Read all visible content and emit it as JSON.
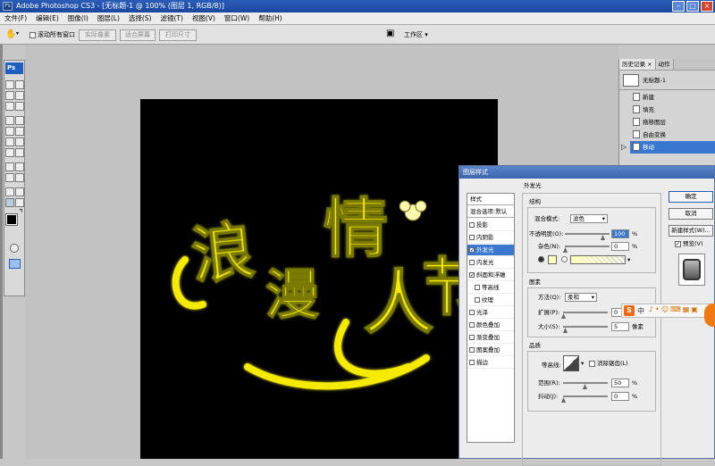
{
  "window": {
    "title": "Adobe Photoshop CS3 - [无标题-1 @ 100% (图层 1, RGB/8)]",
    "app_icon": "Ps"
  },
  "menu": [
    "文件(F)",
    "编辑(E)",
    "图像(I)",
    "图层(L)",
    "选择(S)",
    "滤镜(T)",
    "视图(V)",
    "窗口(W)",
    "帮助(H)"
  ],
  "options_bar": {
    "scroll_all_windows": "滚动所有窗口",
    "actual_pixels": "实际像素",
    "fit_screen": "适合屏幕",
    "print_size": "打印尺寸",
    "workspace": "工作区 ▾"
  },
  "toolbox": {
    "logo": "Ps"
  },
  "document": {
    "artwork_text": "浪漫情人节",
    "background": "#000000",
    "text_color": "#f5ea00"
  },
  "history_panel": {
    "tabs": [
      "历史记录 ×",
      "动作"
    ],
    "snapshot": "无标题-1",
    "steps": [
      "新建",
      "填充",
      "拖移图层",
      "自由变换",
      "移动"
    ],
    "selected_step": "移动"
  },
  "layer_style_dialog": {
    "title": "图层样式",
    "styles_header": "样式",
    "blend_options": "混合选项:默认",
    "styles": [
      {
        "label": "投影",
        "checked": false
      },
      {
        "label": "内阴影",
        "checked": false
      },
      {
        "label": "外发光",
        "checked": true,
        "selected": true
      },
      {
        "label": "内发光",
        "checked": false
      },
      {
        "label": "斜面和浮雕",
        "checked": true
      },
      {
        "label": "等高线",
        "checked": false,
        "sub": true
      },
      {
        "label": "纹理",
        "checked": false,
        "sub": true
      },
      {
        "label": "光泽",
        "checked": false
      },
      {
        "label": "颜色叠加",
        "checked": false
      },
      {
        "label": "渐变叠加",
        "checked": false
      },
      {
        "label": "图案叠加",
        "checked": false
      },
      {
        "label": "描边",
        "checked": false
      }
    ],
    "section_title": "外发光",
    "structure": {
      "title": "结构",
      "blend_mode_label": "混合模式:",
      "blend_mode_value": "滤色",
      "opacity_label": "不透明度(O):",
      "opacity_value": "100",
      "noise_label": "杂色(N):",
      "noise_value": "0",
      "percent": "%"
    },
    "elements": {
      "title": "图素",
      "method_label": "方法(Q):",
      "method_value": "柔和",
      "spread_label": "扩展(P):",
      "spread_value": "0",
      "size_label": "大小(S):",
      "size_value": "5",
      "px_unit": "像素",
      "percent": "%"
    },
    "quality": {
      "title": "品质",
      "contour_label": "等高线:",
      "anti_alias": "消除锯齿(L)",
      "range_label": "范围(R):",
      "range_value": "50",
      "jitter_label": "抖动(J):",
      "jitter_value": "0",
      "percent": "%"
    },
    "buttons": {
      "ok": "确定",
      "cancel": "取消",
      "new_style": "新建样式(W)...",
      "preview": "预览(V)"
    },
    "glow_color": "#ffffc0"
  },
  "ime_bar": {
    "logo": "S",
    "label": "中"
  }
}
